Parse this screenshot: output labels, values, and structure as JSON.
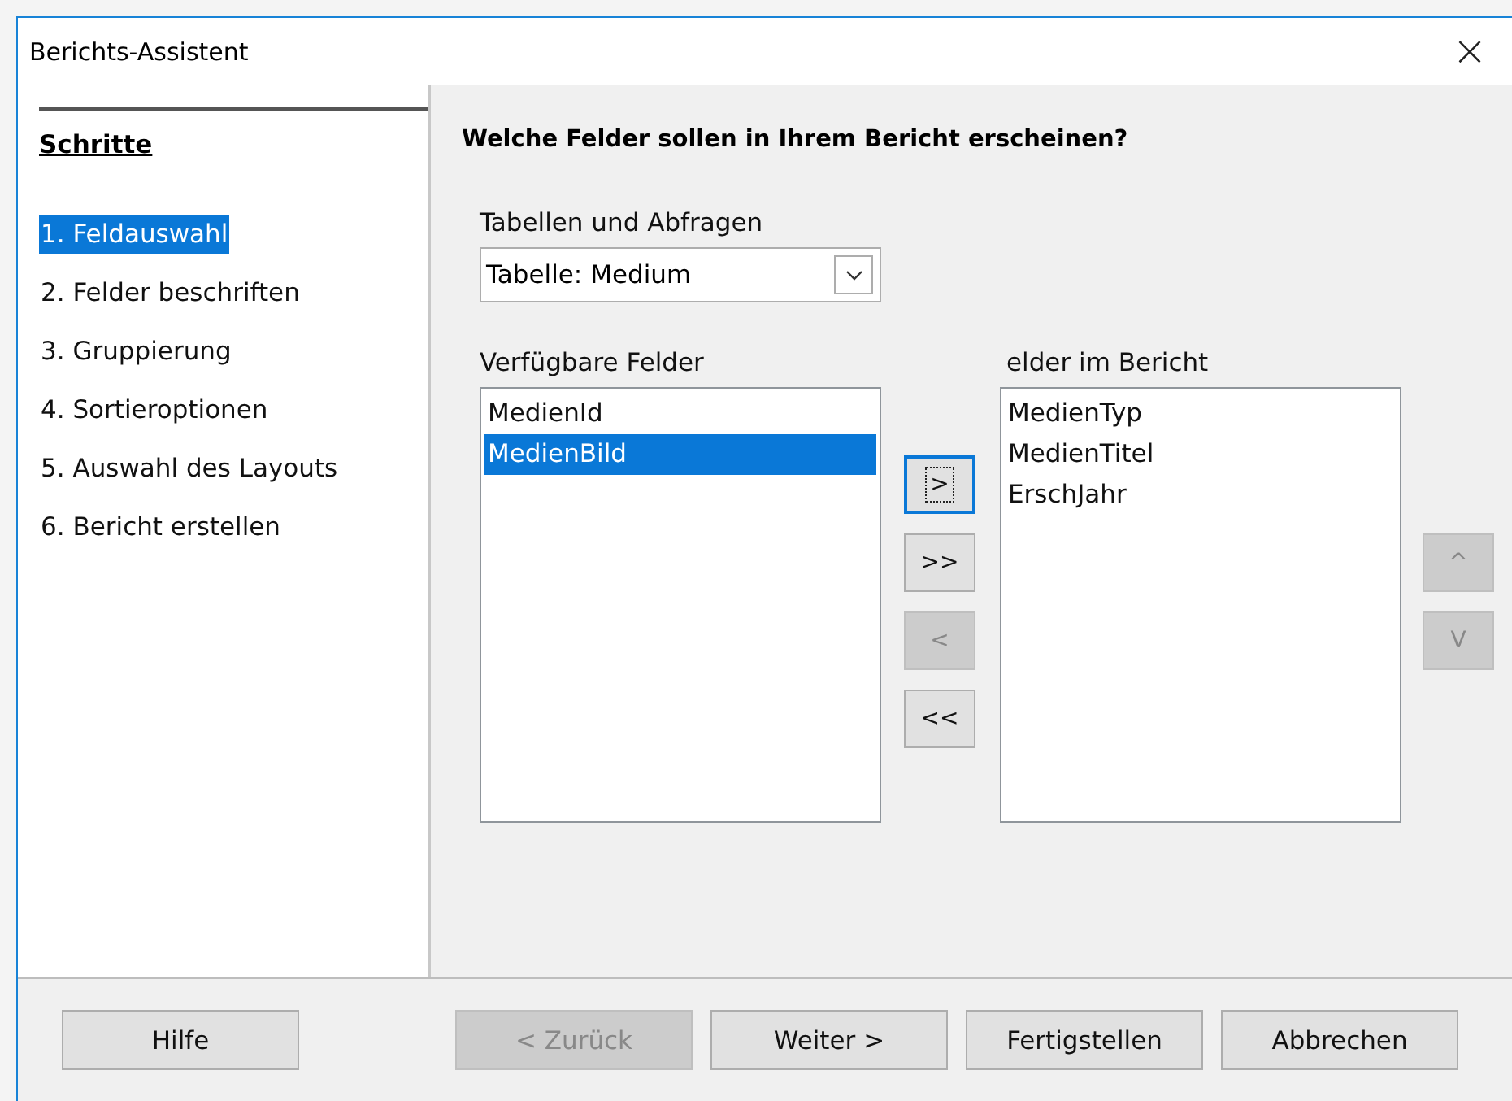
{
  "window": {
    "title": "Berichts-Assistent",
    "close": "×"
  },
  "sidebar": {
    "heading": "Schritte",
    "items": [
      {
        "label": "1. Feldauswahl",
        "selected": true
      },
      {
        "label": "2. Felder beschriften",
        "selected": false
      },
      {
        "label": "3. Gruppierung",
        "selected": false
      },
      {
        "label": "4. Sortieroptionen",
        "selected": false
      },
      {
        "label": "5. Auswahl des Layouts",
        "selected": false
      },
      {
        "label": "6. Bericht erstellen",
        "selected": false
      }
    ]
  },
  "main": {
    "heading": "Welche Felder sollen in Ihrem Bericht erscheinen?",
    "tables_label": "Tabellen und Abfragen",
    "tables_value": "Tabelle: Medium",
    "available_label": "Verfügbare Felder",
    "available": [
      {
        "label": "MedienId",
        "selected": false
      },
      {
        "label": "MedienBild",
        "selected": true
      }
    ],
    "move_buttons": [
      {
        "label": ">",
        "disabled": false,
        "focused": true
      },
      {
        "label": ">>",
        "disabled": false,
        "focused": false
      },
      {
        "label": "<",
        "disabled": true,
        "focused": false
      },
      {
        "label": "<<",
        "disabled": false,
        "focused": false
      }
    ],
    "report_label": "elder im Bericht",
    "report": [
      {
        "label": "MedienTyp",
        "selected": false
      },
      {
        "label": "MedienTitel",
        "selected": false
      },
      {
        "label": "ErschJahr",
        "selected": false
      }
    ],
    "order_buttons": [
      {
        "label": "^",
        "disabled": true
      },
      {
        "label": "V",
        "disabled": true
      }
    ]
  },
  "buttons": [
    {
      "label": "Hilfe",
      "disabled": false
    },
    {
      "label": "< Zurück",
      "disabled": true
    },
    {
      "label": "Weiter >",
      "disabled": false
    },
    {
      "label": "Fertigstellen",
      "disabled": false
    },
    {
      "label": "Abbrechen",
      "disabled": false
    }
  ]
}
